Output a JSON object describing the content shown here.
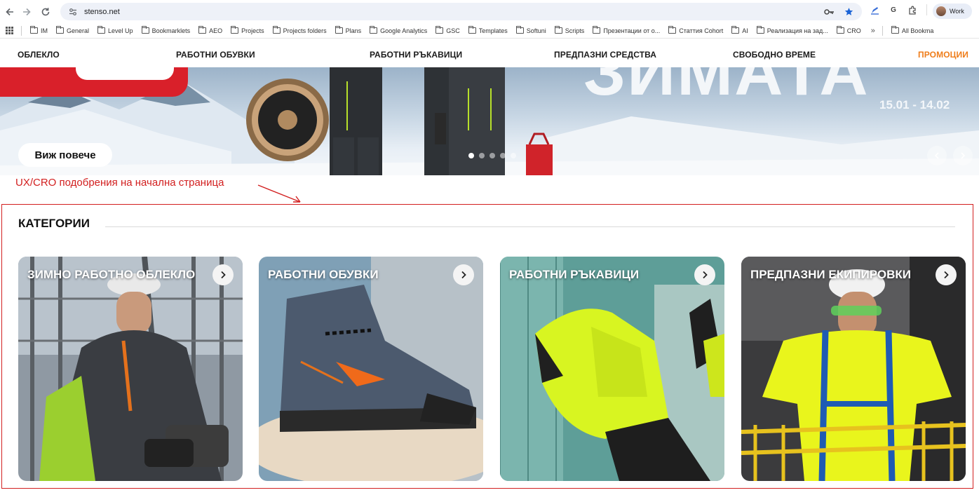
{
  "browser": {
    "url": "stenso.net",
    "profile_label": "Work",
    "extension_g": "G"
  },
  "bookmarks": {
    "items": [
      "IM",
      "General",
      "Level Up",
      "Bookmarklets",
      "AEO",
      "Projects",
      "Projects folders",
      "Plans",
      "Google Analytics",
      "GSC",
      "Templates",
      "Softuni",
      "Scripts",
      "Презентации от о...",
      "Статтия Cohort",
      "AI",
      "Реализация на зад...",
      "CRO"
    ],
    "more": "»",
    "all": "All Bookma"
  },
  "site_nav": {
    "items": [
      "ОБЛЕКЛО",
      "РАБОТНИ ОБУВКИ",
      "РАБОТНИ РЪКАВИЦИ",
      "ПРЕДПАЗНИ СРЕДСТВА",
      "СВОБОДНО ВРЕМЕ"
    ],
    "promo": "ПРОМОЦИИ",
    "promo_color": "#ef7d1a"
  },
  "hero": {
    "big_text": "ЗИМАТА",
    "date_range": "15.01 - 14.02",
    "cta_label": "Виж повече",
    "slide_count": 5,
    "active_slide": 1,
    "brand_red": "#d9202a"
  },
  "annotation": {
    "text": "UX/CRO подобрения на начална страница",
    "color": "#d21f1f"
  },
  "categories": {
    "title": "КАТЕГОРИИ",
    "cards": [
      {
        "title": "ЗИМНО РАБОТНО ОБЛЕКЛО",
        "image": "winter-workwear-photo"
      },
      {
        "title": "РАБОТНИ ОБУВКИ",
        "image": "work-boot-photo"
      },
      {
        "title": "РАБОТНИ РЪКАВИЦИ",
        "image": "work-glove-photo"
      },
      {
        "title": "ПРЕДПАЗНИ ЕКИПИРОВКИ",
        "image": "safety-harness-photo"
      }
    ]
  }
}
